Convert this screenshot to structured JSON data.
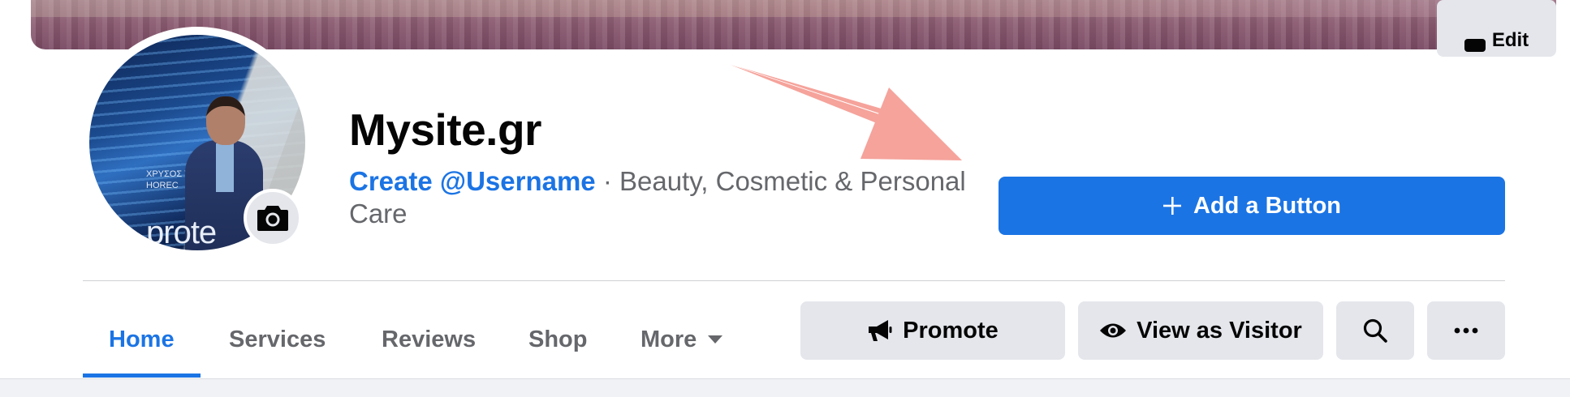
{
  "cover": {
    "edit_label": "Edit"
  },
  "avatar": {
    "brand_text": "prote",
    "sign_text": "ΧΡΥΣΟΣ Υ\nHOREC"
  },
  "profile": {
    "name": "Mysite.gr",
    "username_link": "Create @Username",
    "separator": " · ",
    "category": "Beauty, Cosmetic & Personal Care"
  },
  "add_button": {
    "label": "Add a Button",
    "icon": "plus-icon"
  },
  "tabs": [
    {
      "label": "Home",
      "active": true
    },
    {
      "label": "Services",
      "active": false
    },
    {
      "label": "Reviews",
      "active": false
    },
    {
      "label": "Shop",
      "active": false
    },
    {
      "label": "More",
      "active": false
    }
  ],
  "actions": {
    "promote": {
      "label": "Promote",
      "icon": "megaphone-icon"
    },
    "view_as_visitor": {
      "label": "View as Visitor",
      "icon": "eye-icon"
    },
    "search": {
      "icon": "search-icon"
    },
    "more": {
      "icon": "more-dots-icon"
    }
  },
  "colors": {
    "accent": "#1b74e4",
    "secondary_button": "#e4e6eb",
    "annotation_arrow": "#f5a39b",
    "muted_text": "#65676b"
  }
}
